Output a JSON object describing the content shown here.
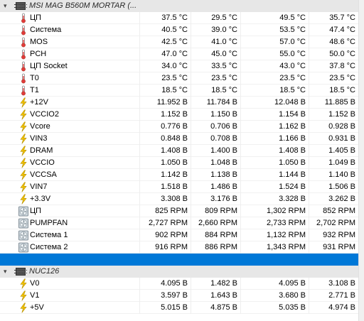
{
  "groups": [
    {
      "title": "MSI MAG B560M MORTAR (...",
      "expand": "▾",
      "rows": [
        {
          "type": "temp",
          "name": "ЦП",
          "v": [
            "37.5 °C",
            "29.5 °C",
            "49.5 °C",
            "35.7 °C"
          ]
        },
        {
          "type": "temp",
          "name": "Система",
          "v": [
            "40.5 °C",
            "39.0 °C",
            "53.5 °C",
            "47.4 °C"
          ]
        },
        {
          "type": "temp",
          "name": "MOS",
          "v": [
            "42.5 °C",
            "41.0 °C",
            "57.0 °C",
            "48.6 °C"
          ]
        },
        {
          "type": "temp",
          "name": "PCH",
          "v": [
            "47.0 °C",
            "45.0 °C",
            "55.0 °C",
            "50.0 °C"
          ]
        },
        {
          "type": "temp",
          "name": "ЦП Socket",
          "v": [
            "34.0 °C",
            "33.5 °C",
            "43.0 °C",
            "37.8 °C"
          ]
        },
        {
          "type": "temp",
          "name": "T0",
          "v": [
            "23.5 °C",
            "23.5 °C",
            "23.5 °C",
            "23.5 °C"
          ]
        },
        {
          "type": "temp",
          "name": "T1",
          "v": [
            "18.5 °C",
            "18.5 °C",
            "18.5 °C",
            "18.5 °C"
          ]
        },
        {
          "type": "volt",
          "name": "+12V",
          "v": [
            "11.952 B",
            "11.784 B",
            "12.048 B",
            "11.885 B"
          ]
        },
        {
          "type": "volt",
          "name": "VCCIO2",
          "v": [
            "1.152 B",
            "1.150 B",
            "1.154 B",
            "1.152 B"
          ]
        },
        {
          "type": "volt",
          "name": "Vcore",
          "v": [
            "0.776 B",
            "0.706 B",
            "1.162 B",
            "0.928 B"
          ]
        },
        {
          "type": "volt",
          "name": "VIN3",
          "v": [
            "0.848 B",
            "0.708 B",
            "1.166 B",
            "0.931 B"
          ]
        },
        {
          "type": "volt",
          "name": "DRAM",
          "v": [
            "1.408 B",
            "1.400 B",
            "1.408 B",
            "1.405 B"
          ]
        },
        {
          "type": "volt",
          "name": "VCCIO",
          "v": [
            "1.050 B",
            "1.048 B",
            "1.050 B",
            "1.049 B"
          ]
        },
        {
          "type": "volt",
          "name": "VCCSA",
          "v": [
            "1.142 B",
            "1.138 B",
            "1.144 B",
            "1.140 B"
          ]
        },
        {
          "type": "volt",
          "name": "VIN7",
          "v": [
            "1.518 B",
            "1.486 B",
            "1.524 B",
            "1.506 B"
          ]
        },
        {
          "type": "volt",
          "name": "+3.3V",
          "v": [
            "3.308 B",
            "3.176 B",
            "3.328 B",
            "3.262 B"
          ]
        },
        {
          "type": "fan",
          "name": "ЦП",
          "v": [
            "825 RPM",
            "809 RPM",
            "1,302 RPM",
            "852 RPM"
          ]
        },
        {
          "type": "fan",
          "name": "PUMPFAN",
          "v": [
            "2,727 RPM",
            "2,660 RPM",
            "2,733 RPM",
            "2,702 RPM"
          ]
        },
        {
          "type": "fan",
          "name": "Система 1",
          "v": [
            "902 RPM",
            "884 RPM",
            "1,132 RPM",
            "932 RPM"
          ]
        },
        {
          "type": "fan",
          "name": "Система 2",
          "v": [
            "916 RPM",
            "886 RPM",
            "1,343 RPM",
            "931 RPM"
          ]
        }
      ]
    },
    {
      "title": "NUC126",
      "expand": "▾",
      "rows": [
        {
          "type": "volt",
          "name": "V0",
          "v": [
            "4.095 B",
            "1.482 B",
            "4.095 B",
            "3.108 B"
          ]
        },
        {
          "type": "volt",
          "name": "V1",
          "v": [
            "3.597 B",
            "1.643 B",
            "3.680 B",
            "2.771 B"
          ]
        },
        {
          "type": "volt",
          "name": "+5V",
          "v": [
            "5.015 B",
            "4.875 B",
            "5.035 B",
            "4.974 B"
          ]
        }
      ]
    }
  ],
  "icons": {
    "temp": "thermometer-icon",
    "volt": "lightning-icon",
    "fan": "fan-icon",
    "group": "chip-icon"
  },
  "colors": {
    "selection": "#0078d7",
    "group_bg": "#e7e7e7",
    "bolt": "#f2c200",
    "thermo": "#e23b3b"
  }
}
